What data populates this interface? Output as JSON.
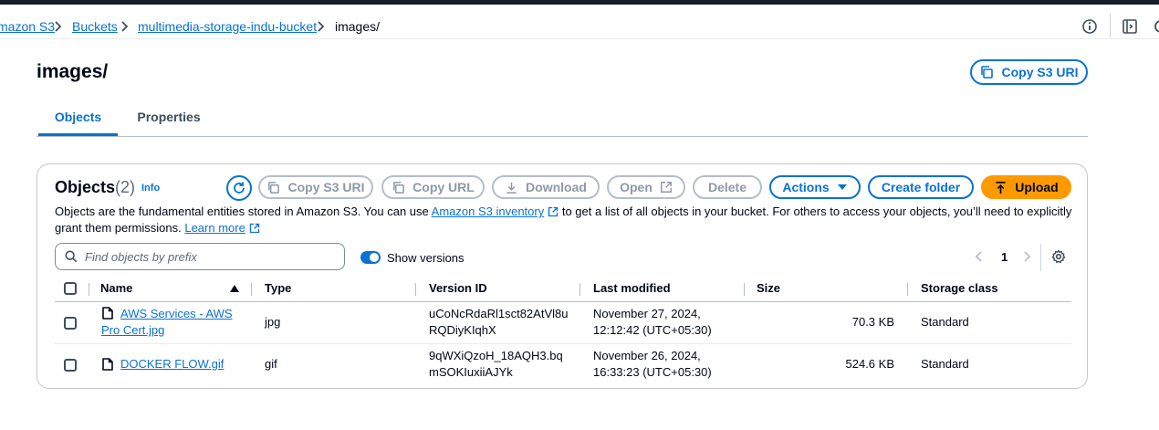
{
  "breadcrumb": {
    "items": [
      {
        "label": "mazon S3"
      },
      {
        "label": "Buckets"
      },
      {
        "label": "multimedia-storage-indu-bucket"
      },
      {
        "label": "images/"
      }
    ]
  },
  "page": {
    "title": "images/",
    "copy_s3_uri_label": "Copy S3 URI"
  },
  "tabs": [
    {
      "label": "Objects"
    },
    {
      "label": "Properties"
    }
  ],
  "objects": {
    "title": "Objects",
    "count": "(2)",
    "info_label": "Info",
    "toolbar": {
      "copy_s3_uri": "Copy S3 URI",
      "copy_url": "Copy URL",
      "download": "Download",
      "open": "Open",
      "delete": "Delete",
      "actions": "Actions",
      "create_folder": "Create folder",
      "upload": "Upload"
    },
    "description": {
      "part1": "Objects are the fundamental entities stored in Amazon S3. You can use ",
      "inventory_link": "Amazon S3 inventory",
      "part2": " to get a list of all objects in your bucket. For others to access your objects, you’ll need to explicitly grant them permissions. ",
      "learn_more": "Learn more"
    },
    "search": {
      "placeholder": "Find objects by prefix",
      "value": ""
    },
    "show_versions": {
      "label": "Show versions",
      "enabled": true
    },
    "pagination": {
      "current_page": "1"
    },
    "columns": [
      "Name",
      "Type",
      "Version ID",
      "Last modified",
      "Size",
      "Storage class"
    ],
    "rows": [
      {
        "name_line1": "AWS Services - AWS",
        "name_line2": "Pro Cert.jpg",
        "type": "jpg",
        "version_line1": "uCoNcRdaRl1sct82AtVl8u",
        "version_line2": "RQDiyKIqhX",
        "modified_line1": "November 27, 2024,",
        "modified_line2": "12:12:42 (UTC+05:30)",
        "size": "70.3 KB",
        "storage_class": "Standard"
      },
      {
        "name_line1": "DOCKER FLOW.gif",
        "name_line2": "",
        "type": "gif",
        "version_line1": "9qWXiQzoH_18AQH3.bq",
        "version_line2": "mSOKIuxiiAJYk",
        "modified_line1": "November 26, 2024,",
        "modified_line2": "16:33:23 (UTC+05:30)",
        "size": "524.6 KB",
        "storage_class": "Standard"
      }
    ]
  },
  "colors": {
    "link": "#0972d3",
    "primary": "#ff9900",
    "disabled": "#8d99a8",
    "text": "#000716"
  },
  "icons": [
    "chevron-right-icon",
    "info-circle-icon",
    "panel-icon",
    "copy-icon",
    "refresh-icon",
    "download-icon",
    "external-link-icon",
    "caret-down-icon",
    "upload-icon",
    "search-icon",
    "chevron-left-icon",
    "gear-icon",
    "file-icon",
    "sort-up-icon"
  ]
}
